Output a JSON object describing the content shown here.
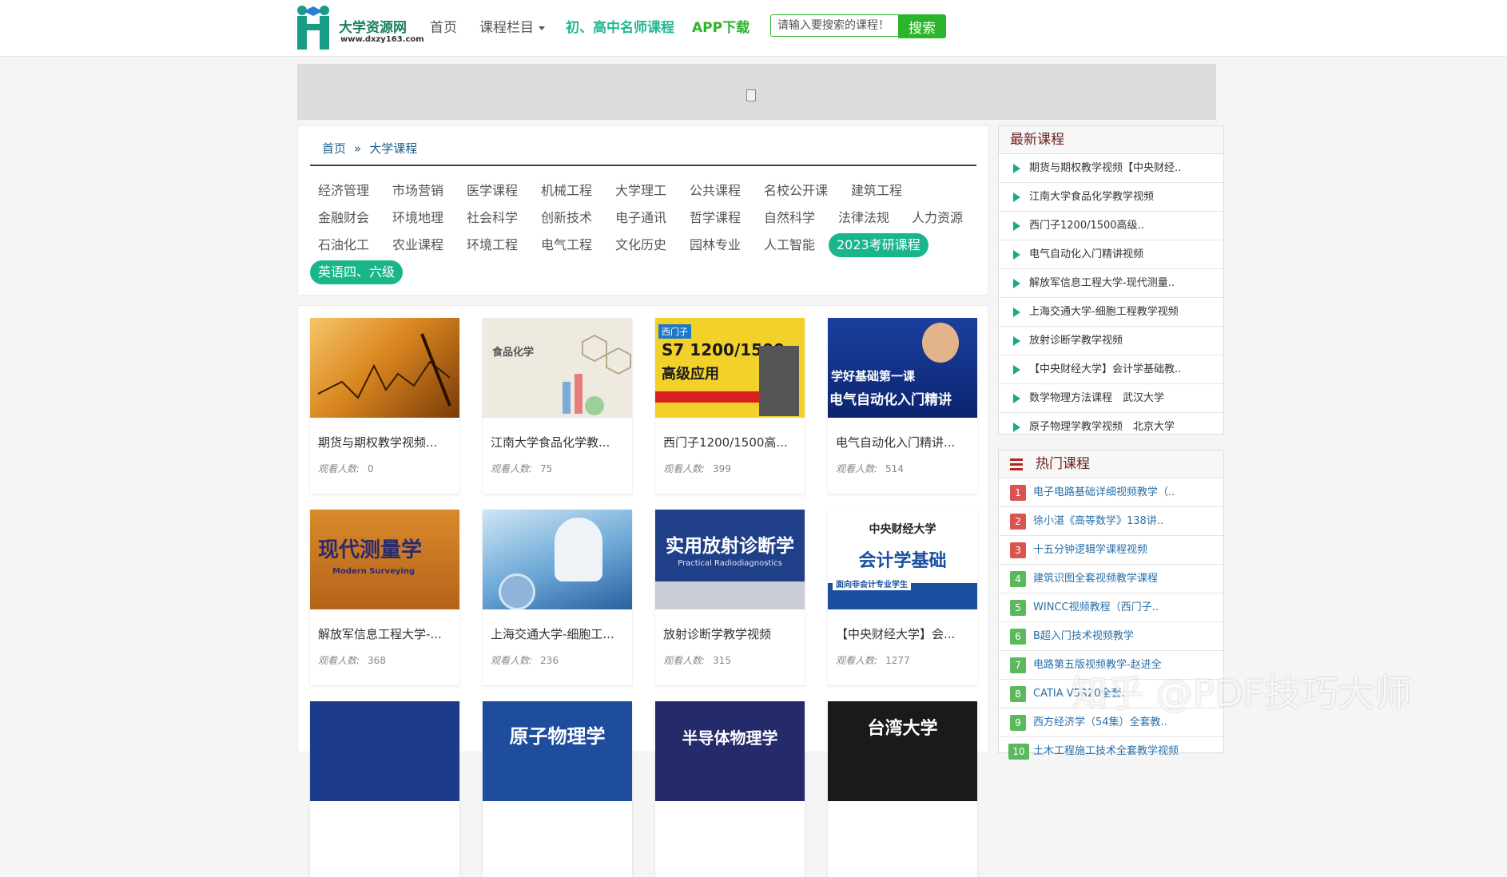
{
  "header": {
    "logo_title": "大学资源网",
    "logo_subtitle": "www.dxzy163.com",
    "nav": {
      "home": "首页",
      "columns": "课程栏目",
      "famous": "初、高中名师课程",
      "app": "APP下载"
    },
    "search": {
      "placeholder": "请输入要搜索的课程！",
      "button": "搜索"
    }
  },
  "breadcrumb": {
    "home": "首页",
    "separator": "»",
    "current": "大学课程"
  },
  "categories": [
    "经济管理",
    "市场营销",
    "医学课程",
    "机械工程",
    "大学理工",
    "公共课程",
    "名校公开课",
    "建筑工程",
    "金融财会",
    "环境地理",
    "社会科学",
    "创新技术",
    "电子通讯",
    "哲学课程",
    "自然科学",
    "法律法规",
    "人力资源",
    "石油化工",
    "农业课程",
    "环境工程",
    "电气工程",
    "文化历史",
    "园林专业",
    "人工智能",
    "2023考研课程",
    "英语四、六级"
  ],
  "views_label": "观看人数:",
  "courses": [
    {
      "title": "期货与期权教学视频...",
      "views": "0",
      "thumb_text": ""
    },
    {
      "title": "江南大学食品化学教...",
      "views": "75",
      "thumb_text": "食品化学"
    },
    {
      "title": "西门子1200/1500高...",
      "views": "399",
      "thumb_text": "S7 1200/1500"
    },
    {
      "title": "电气自动化入门精讲...",
      "views": "514",
      "thumb_text": "电气自动化入门精讲"
    },
    {
      "title": "解放军信息工程大学-...",
      "views": "368",
      "thumb_text": "现代测量学"
    },
    {
      "title": "上海交通大学-细胞工...",
      "views": "236",
      "thumb_text": ""
    },
    {
      "title": "放射诊断学教学视频",
      "views": "315",
      "thumb_text": "实用放射诊断学"
    },
    {
      "title": "【中央财经大学】会...",
      "views": "1277",
      "thumb_text": "会计学基础"
    },
    {
      "title": "",
      "views": "",
      "thumb_text": ""
    },
    {
      "title": "",
      "views": "",
      "thumb_text": "原子物理学"
    },
    {
      "title": "",
      "views": "",
      "thumb_text": "半导体物理学"
    },
    {
      "title": "",
      "views": "",
      "thumb_text": "台湾大学"
    }
  ],
  "thumb_extra": {
    "siemens_brand": "西门子",
    "siemens_sub": "高级应用",
    "elec_top": "学好基础第一课",
    "survey_en": "Modern Surveying",
    "radio_en": "Practical Radiodiagnostics",
    "cufe_name": "中央财经大学",
    "cufe_sub": "面向非会计专业学生"
  },
  "latest": {
    "title": "最新课程",
    "items": [
      "期货与期权教学视频【中央财经..",
      "江南大学食品化学教学视频",
      "西门子1200/1500高级..",
      "电气自动化入门精讲视频",
      "解放军信息工程大学-现代测量..",
      "上海交通大学-细胞工程教学视频",
      "放射诊断学教学视频",
      "【中央财经大学】会计学基础教..",
      "数学物理方法课程　武汉大学",
      "原子物理学教学视频　北京大学"
    ]
  },
  "hot": {
    "title": "热门课程",
    "items": [
      {
        "rank": "1",
        "label": "电子电路基础详细视频教学（..",
        "color": "#d9534f"
      },
      {
        "rank": "2",
        "label": "徐小湛《高等数学》138讲..",
        "color": "#d9534f"
      },
      {
        "rank": "3",
        "label": "十五分钟逻辑学课程视频",
        "color": "#d9534f"
      },
      {
        "rank": "4",
        "label": "建筑识图全套视频教学课程",
        "color": "#5cb85c"
      },
      {
        "rank": "5",
        "label": "WINCC视频教程（西门子..",
        "color": "#5cb85c"
      },
      {
        "rank": "6",
        "label": "B超入门技术视频教学",
        "color": "#5cb85c"
      },
      {
        "rank": "7",
        "label": "电路第五版视频教学-赵进全",
        "color": "#5cb85c"
      },
      {
        "rank": "8",
        "label": "CATIA V5R20全套..",
        "color": "#5cb85c"
      },
      {
        "rank": "9",
        "label": "西方经济学（54集）全套教..",
        "color": "#5cb85c"
      },
      {
        "rank": "10",
        "label": "土木工程施工技术全套教学视频",
        "color": "#5cb85c"
      }
    ]
  },
  "watermark": "知乎 @PDF技巧大师",
  "colors": {
    "accent": "#19b68b",
    "search_green": "#2bb52b",
    "link_blue": "#1b5e8a"
  }
}
